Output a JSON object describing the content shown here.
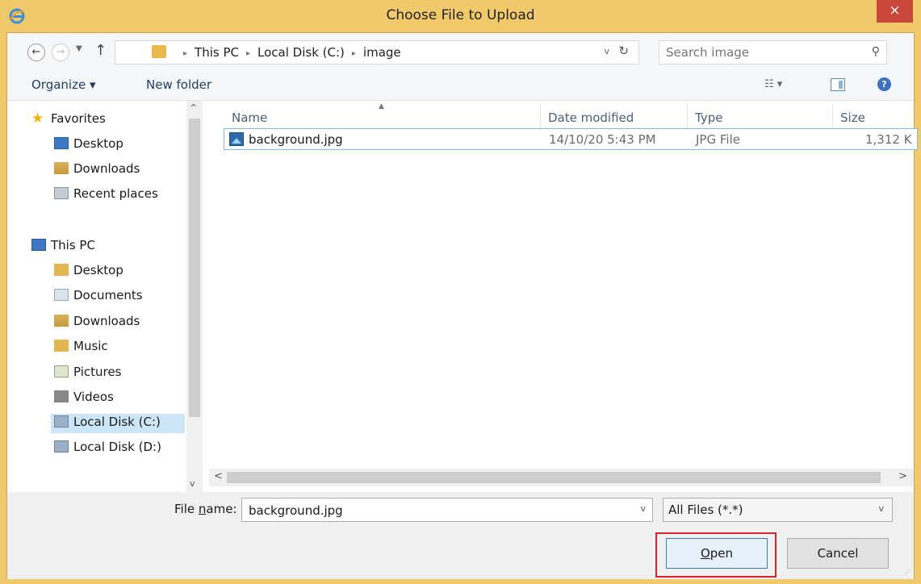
{
  "window": {
    "title": "Choose File to Upload",
    "close_label": "×"
  },
  "address": {
    "crumbs": [
      "This PC",
      "Local Disk (C:)",
      "image"
    ],
    "separator": "▸",
    "dropdown_glyph": "v",
    "refresh_glyph": "↻"
  },
  "search": {
    "placeholder": "Search image"
  },
  "toolbar": {
    "organize_label": "Organize ▾",
    "new_folder_label": "New folder",
    "views_glyph": "☷ ▾",
    "help_glyph": "?"
  },
  "navpane": {
    "favorites_label": "Favorites",
    "favorites": [
      {
        "label": "Desktop",
        "icon": "desktop-icon"
      },
      {
        "label": "Downloads",
        "icon": "downloads-icon"
      },
      {
        "label": "Recent places",
        "icon": "recent-places-icon"
      }
    ],
    "this_pc_label": "This PC",
    "this_pc": [
      {
        "label": "Desktop",
        "icon": "desktop-folder-icon"
      },
      {
        "label": "Documents",
        "icon": "documents-icon"
      },
      {
        "label": "Downloads",
        "icon": "downloads-icon"
      },
      {
        "label": "Music",
        "icon": "music-icon"
      },
      {
        "label": "Pictures",
        "icon": "pictures-icon"
      },
      {
        "label": "Videos",
        "icon": "videos-icon"
      },
      {
        "label": "Local Disk (C:)",
        "icon": "disk-icon",
        "selected": true
      },
      {
        "label": "Local Disk (D:)",
        "icon": "disk-icon"
      }
    ]
  },
  "filelist": {
    "columns": [
      "Name",
      "Date modified",
      "Type",
      "Size"
    ],
    "rows": [
      {
        "name": "background.jpg",
        "date": "14/10/20 5:43 PM",
        "type": "JPG File",
        "size": "1,312 K"
      }
    ]
  },
  "bottom": {
    "file_name_label_pre": "File ",
    "file_name_label_ul": "n",
    "file_name_label_post": "ame:",
    "file_name_value": "background.jpg",
    "file_type_value": "All Files (*.*)",
    "open_label_ul": "O",
    "open_label_rest": "pen",
    "cancel_label": "Cancel"
  },
  "colors": {
    "frame": "#f0c96a",
    "close": "#c9463a",
    "highlight": "#d9232b"
  }
}
